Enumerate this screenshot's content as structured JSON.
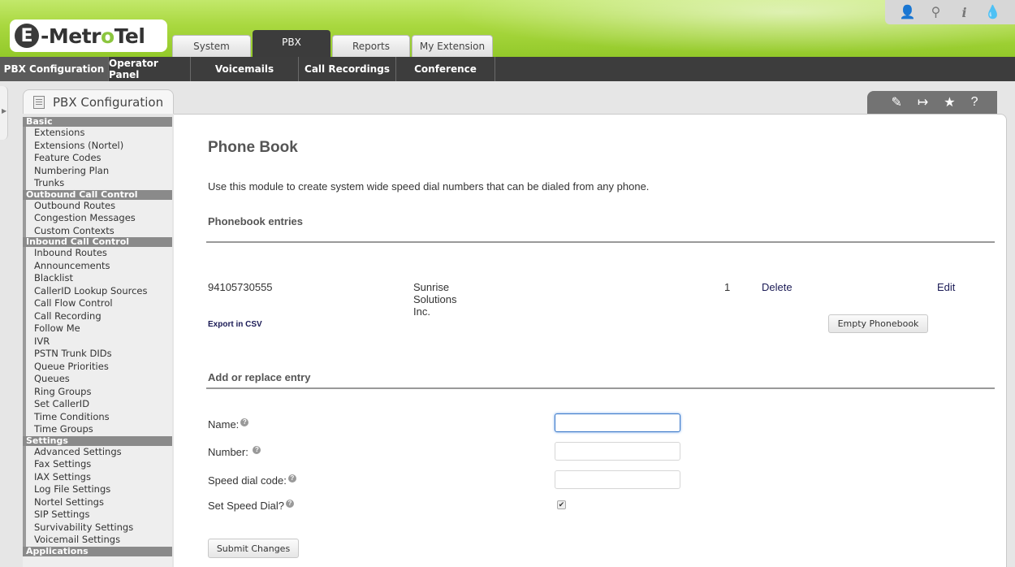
{
  "brand": {
    "logo_letter": "E",
    "logo_text_pre": "-Metr",
    "logo_text_o": "o",
    "logo_text_post": "Tel"
  },
  "top_icons": [
    "user-icon",
    "search-icon",
    "info-icon",
    "drop-icon"
  ],
  "tabs": [
    {
      "label": "System",
      "active": false
    },
    {
      "label": "PBX",
      "active": true
    },
    {
      "label": "Reports",
      "active": false
    },
    {
      "label": "My Extension",
      "active": false
    }
  ],
  "menubar": [
    {
      "label": "PBX Configuration",
      "active": true
    },
    {
      "label": "Operator Panel",
      "active": false
    },
    {
      "label": "Voicemails",
      "active": false
    },
    {
      "label": "Call Recordings",
      "active": false
    },
    {
      "label": "Conference",
      "active": false
    }
  ],
  "module_tab": {
    "label": "PBX Configuration"
  },
  "sidebar": {
    "sections": [
      {
        "title": "Basic",
        "items": [
          "Extensions",
          "Extensions (Nortel)",
          "Feature Codes",
          "Numbering Plan",
          "Trunks"
        ]
      },
      {
        "title": "Outbound Call Control",
        "items": [
          "Outbound Routes",
          "Congestion Messages",
          "Custom Contexts"
        ]
      },
      {
        "title": "Inbound Call Control",
        "items": [
          "Inbound Routes",
          "Announcements",
          "Blacklist",
          "CallerID Lookup Sources",
          "Call Flow Control",
          "Call Recording",
          "Follow Me",
          "IVR",
          "PSTN Trunk DIDs",
          "Queue Priorities",
          "Queues",
          "Ring Groups",
          "Set CallerID",
          "Time Conditions",
          "Time Groups"
        ]
      },
      {
        "title": "Settings",
        "items": [
          "Advanced Settings",
          "Fax Settings",
          "IAX Settings",
          "Log File Settings",
          "Nortel Settings",
          "SIP Settings",
          "Survivability Settings",
          "Voicemail Settings"
        ]
      },
      {
        "title": "Applications",
        "items": []
      }
    ]
  },
  "main": {
    "title": "Phone Book",
    "description": "Use this module to create system wide speed dial numbers that can be dialed from any phone.",
    "entries_heading": "Phonebook entries",
    "entries": [
      {
        "number": "94105730555",
        "name": "Sunrise Solutions Inc.",
        "speed_dial": "1",
        "delete_label": "Delete",
        "edit_label": "Edit"
      }
    ],
    "export_label": "Export in CSV",
    "empty_label": "Empty Phonebook",
    "form_heading": "Add or replace entry",
    "form": {
      "name_label": "Name:",
      "number_label": "Number:",
      "speed_label": "Speed dial code:",
      "set_speed_label": "Set Speed Dial?",
      "name_value": "",
      "number_value": "",
      "speed_value": "",
      "set_speed_checked": "✔",
      "submit_label": "Submit Changes"
    }
  }
}
